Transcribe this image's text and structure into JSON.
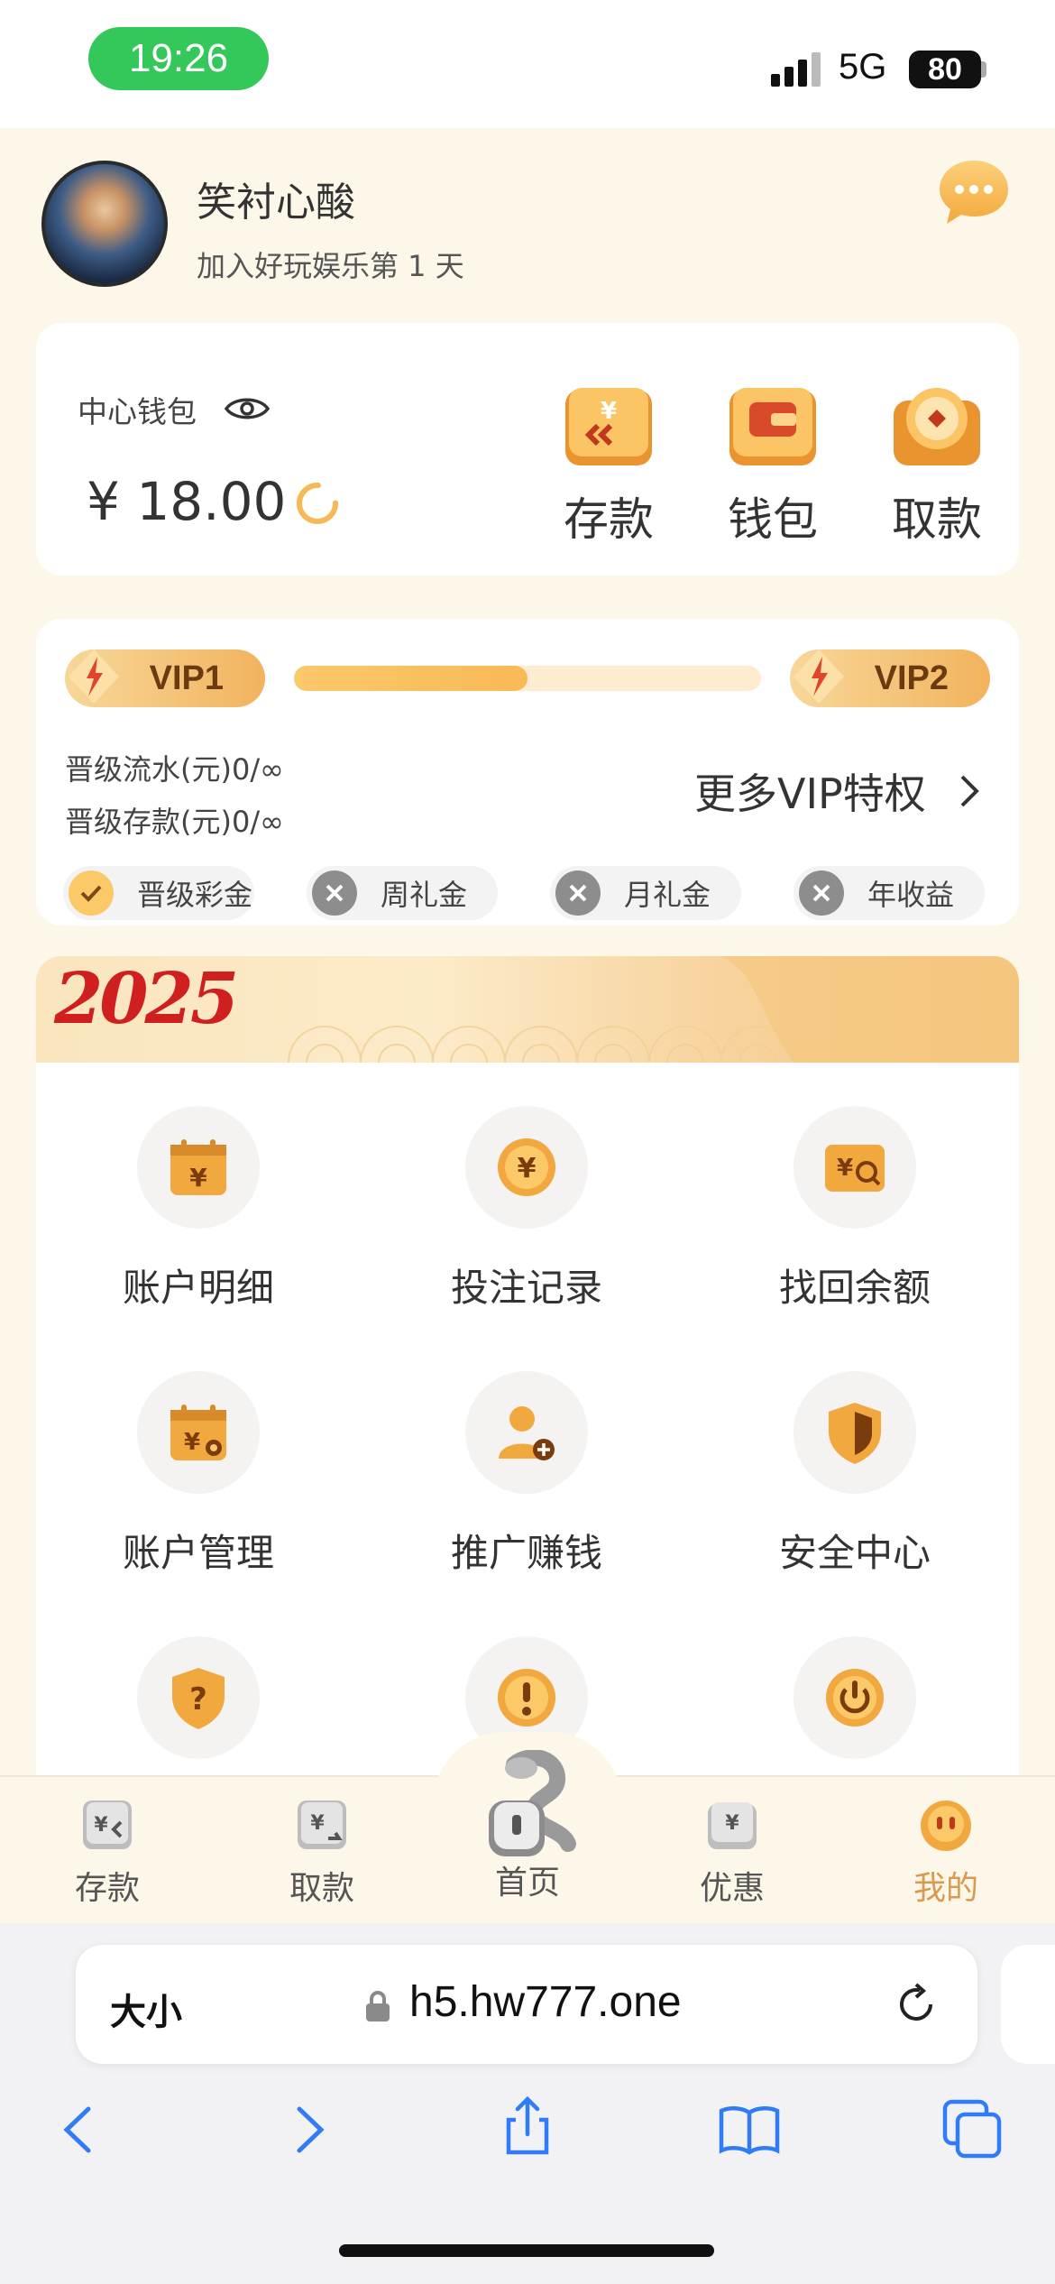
{
  "status_bar": {
    "time": "19:26",
    "network": "5G",
    "battery": "80"
  },
  "profile": {
    "username": "笑衬心酸",
    "joined": "加入好玩娱乐第 1 天"
  },
  "wallet": {
    "label": "中心钱包",
    "balance": "¥ 18.00",
    "actions": [
      {
        "label": "存款",
        "icon": "deposit-icon"
      },
      {
        "label": "钱包",
        "icon": "wallet-icon"
      },
      {
        "label": "取款",
        "icon": "withdraw-icon"
      }
    ]
  },
  "vip": {
    "current": "VIP1",
    "next": "VIP2",
    "progress": 0.5,
    "requirements": [
      "晋级流水(元)0/∞",
      "晋级存款(元)0/∞"
    ],
    "more_label": "更多VIP特权",
    "perks": [
      {
        "label": "晋级彩金",
        "status": "checked"
      },
      {
        "label": "周礼金",
        "status": "unavailable"
      },
      {
        "label": "月礼金",
        "status": "unavailable"
      },
      {
        "label": "年收益",
        "status": "unavailable"
      }
    ]
  },
  "banner": {
    "year": "2025"
  },
  "menu": [
    {
      "label": "账户明细",
      "icon": "account-detail-icon"
    },
    {
      "label": "投注记录",
      "icon": "bet-record-icon"
    },
    {
      "label": "找回余额",
      "icon": "recover-balance-icon"
    },
    {
      "label": "账户管理",
      "icon": "account-manage-icon"
    },
    {
      "label": "推广赚钱",
      "icon": "promote-earn-icon"
    },
    {
      "label": "安全中心",
      "icon": "security-center-icon"
    },
    {
      "label": "",
      "icon": "help-icon"
    },
    {
      "label": "",
      "icon": "notice-icon"
    },
    {
      "label": "",
      "icon": "logout-icon"
    }
  ],
  "tabbar": {
    "tabs": [
      {
        "label": "存款",
        "icon": "deposit-tab-icon"
      },
      {
        "label": "取款",
        "icon": "withdraw-tab-icon"
      },
      {
        "label": "首页",
        "icon": "home-snake-icon"
      },
      {
        "label": "优惠",
        "icon": "promo-tab-icon"
      },
      {
        "label": "我的",
        "icon": "mine-tab-icon"
      }
    ],
    "active_color": "#d99a4e"
  },
  "browser": {
    "text_size": "大小",
    "url": "h5.hw777.one"
  },
  "colors": {
    "accent": "#f5b04a",
    "brand_gold": "#e8a03c",
    "status_green": "#34c759"
  }
}
